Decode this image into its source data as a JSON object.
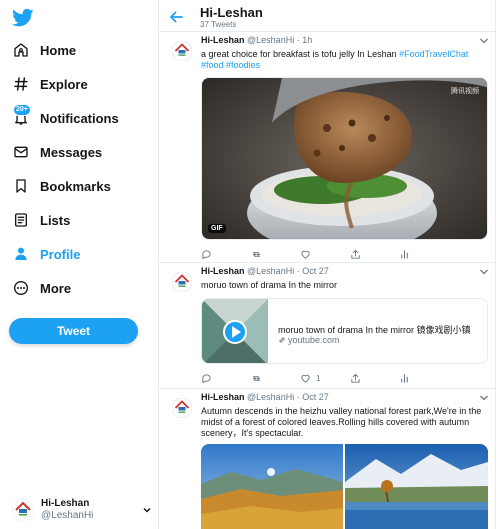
{
  "nav": {
    "items": [
      {
        "label": "Home",
        "icon": "home-icon"
      },
      {
        "label": "Explore",
        "icon": "hashtag-icon"
      },
      {
        "label": "Notifications",
        "icon": "bell-icon",
        "badge": "20+"
      },
      {
        "label": "Messages",
        "icon": "envelope-icon"
      },
      {
        "label": "Bookmarks",
        "icon": "bookmark-icon"
      },
      {
        "label": "Lists",
        "icon": "list-icon"
      },
      {
        "label": "Profile",
        "icon": "person-icon",
        "active": true
      },
      {
        "label": "More",
        "icon": "more-icon"
      }
    ],
    "tweet_button": "Tweet",
    "account": {
      "name": "Hi-Leshan",
      "handle": "@LeshanHi"
    }
  },
  "header": {
    "title": "Hi-Leshan",
    "count": "37 Tweets"
  },
  "tweets": [
    {
      "name": "Hi-Leshan",
      "handle": "@LeshanHi",
      "time": "1h",
      "text": "a great choice for breakfast is tofu jelly In Leshan ",
      "tags": [
        "#FoodTravelChat",
        "#food",
        "#foodies"
      ],
      "media_badge": "GIF",
      "media_watermark": "腾讯视频",
      "actions": {
        "reply": "",
        "retweet": "",
        "like": "",
        "share": ""
      }
    },
    {
      "name": "Hi-Leshan",
      "handle": "@LeshanHi",
      "time": "Oct 27",
      "text": "moruo town of drama In the mirror",
      "card": {
        "title": "moruo town of drama In the mirror 镜像戏剧小镇",
        "domain": "youtube.com"
      },
      "actions": {
        "reply": "",
        "retweet": "",
        "like": "1",
        "share": ""
      }
    },
    {
      "name": "Hi-Leshan",
      "handle": "@LeshanHi",
      "time": "Oct 27",
      "text": "Autumn descends in the heizhu valley national forest park,We're in the midst of a forest of colored leaves.Rolling hills covered with autumn scenery，It's spectacular."
    }
  ],
  "colors": {
    "accent": "#1da1f2",
    "text": "#14171a",
    "muted": "#657786",
    "border": "#e6ecf0"
  }
}
